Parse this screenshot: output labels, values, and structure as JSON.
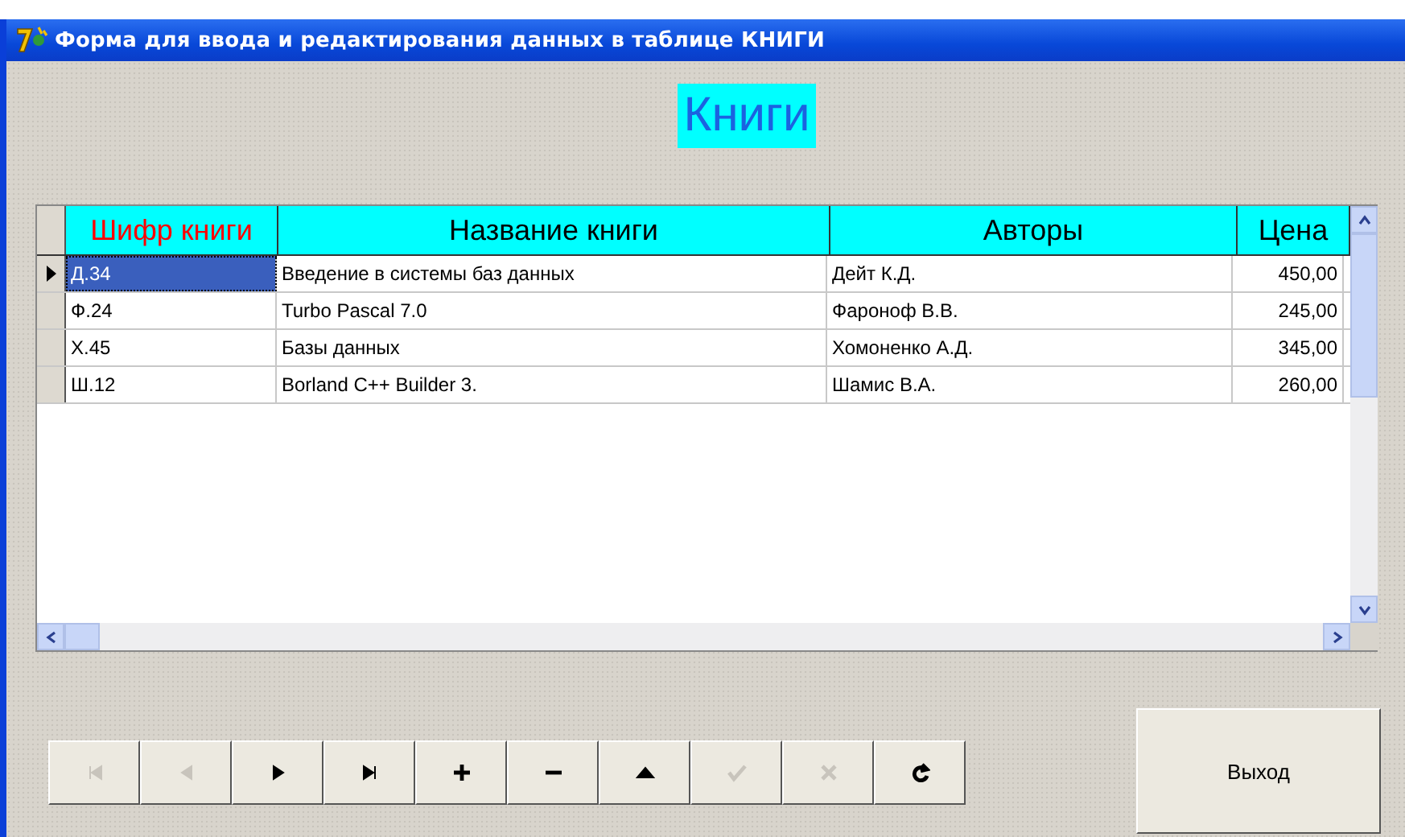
{
  "window": {
    "title": "Форма для ввода и редактирования данных в таблице КНИГИ"
  },
  "heading": "Книги",
  "table": {
    "columns": [
      {
        "label": "Шифр книги",
        "color": "#ff0000"
      },
      {
        "label": "Название книги",
        "color": "#000000"
      },
      {
        "label": "Авторы",
        "color": "#000000"
      },
      {
        "label": "Цена",
        "color": "#000000"
      }
    ],
    "rows": [
      {
        "selected": true,
        "cells": [
          "Д.34",
          "Введение в системы баз данных",
          "Дейт К.Д.",
          "450,00"
        ]
      },
      {
        "selected": false,
        "cells": [
          "Ф.24",
          "Turbo Pascal 7.0",
          "Фароноф В.В.",
          "245,00"
        ]
      },
      {
        "selected": false,
        "cells": [
          "Х.45",
          "Базы данных",
          "Хомоненко А.Д.",
          "345,00"
        ]
      },
      {
        "selected": false,
        "cells": [
          "Ш.12",
          "Borland C++ Builder 3.",
          "Шамис В.А.",
          "260,00"
        ]
      }
    ]
  },
  "navigator": [
    {
      "kind": "first",
      "disabled": true
    },
    {
      "kind": "prior",
      "disabled": true
    },
    {
      "kind": "next",
      "disabled": false
    },
    {
      "kind": "last",
      "disabled": false
    },
    {
      "kind": "insert",
      "disabled": false
    },
    {
      "kind": "delete",
      "disabled": false
    },
    {
      "kind": "edit",
      "disabled": false
    },
    {
      "kind": "post",
      "disabled": true
    },
    {
      "kind": "cancel",
      "disabled": true
    },
    {
      "kind": "refresh",
      "disabled": false
    }
  ],
  "exit_button": "Выход"
}
